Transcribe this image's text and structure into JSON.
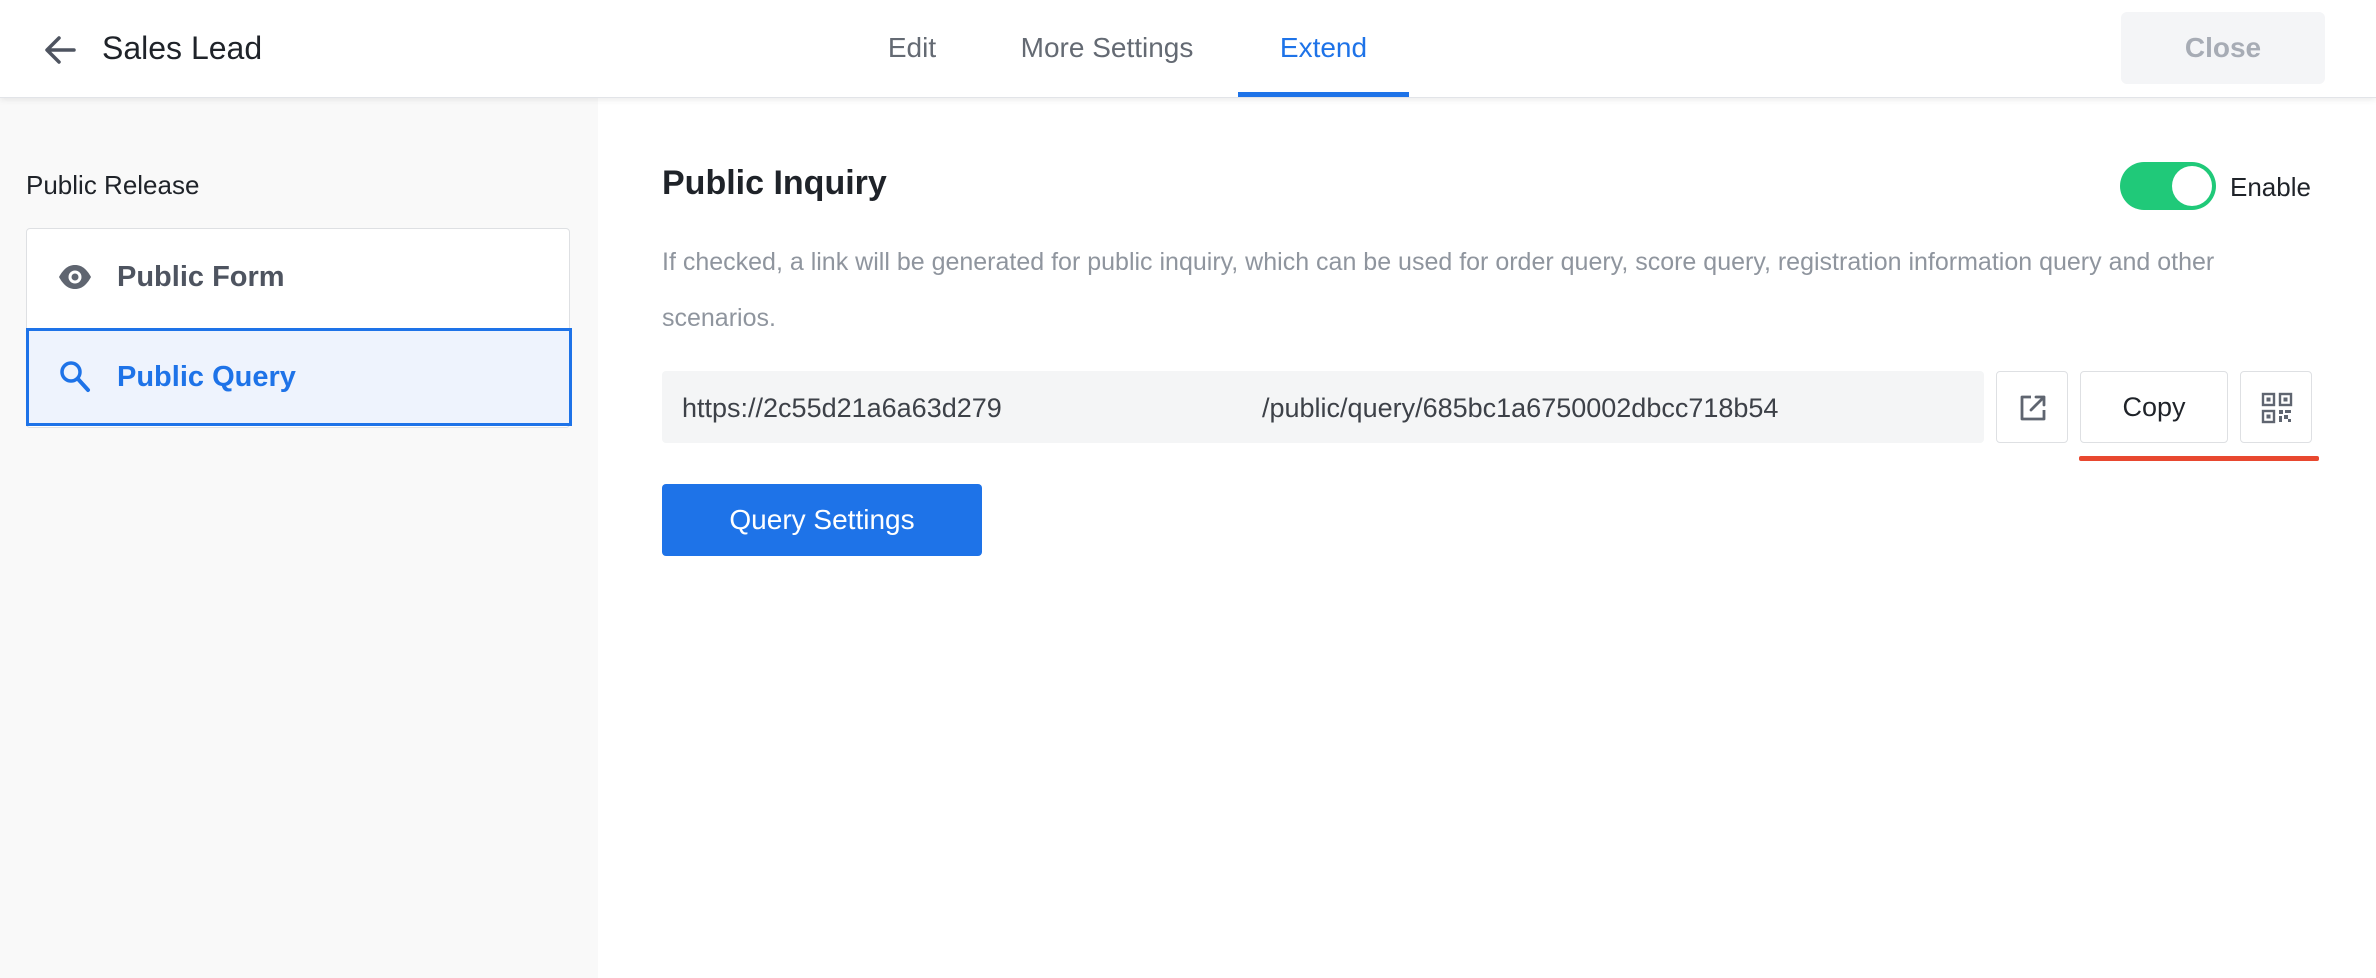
{
  "header": {
    "title": "Sales Lead",
    "tabs": [
      {
        "label": "Edit"
      },
      {
        "label": "More Settings"
      },
      {
        "label": "Extend"
      }
    ],
    "close_label": "Close"
  },
  "sidebar": {
    "heading": "Public Release",
    "items": [
      {
        "label": "Public Form",
        "icon": "eye-icon"
      },
      {
        "label": "Public Query",
        "icon": "search-icon"
      }
    ]
  },
  "main": {
    "title": "Public Inquiry",
    "toggle_label": "Enable",
    "toggle_on": true,
    "description": "If checked, a link will be generated for public inquiry, which can be used for order query, score query, registration information query and other scenarios.",
    "url_part_1": "https://2c55d21a6a63d279",
    "url_part_2": "/public/query/685bc1a6750002dbcc718b54",
    "copy_label": "Copy",
    "query_settings_label": "Query Settings"
  },
  "colors": {
    "accent": "#1e73e8",
    "toggle_on": "#20c979",
    "highlight": "#e8482f"
  }
}
